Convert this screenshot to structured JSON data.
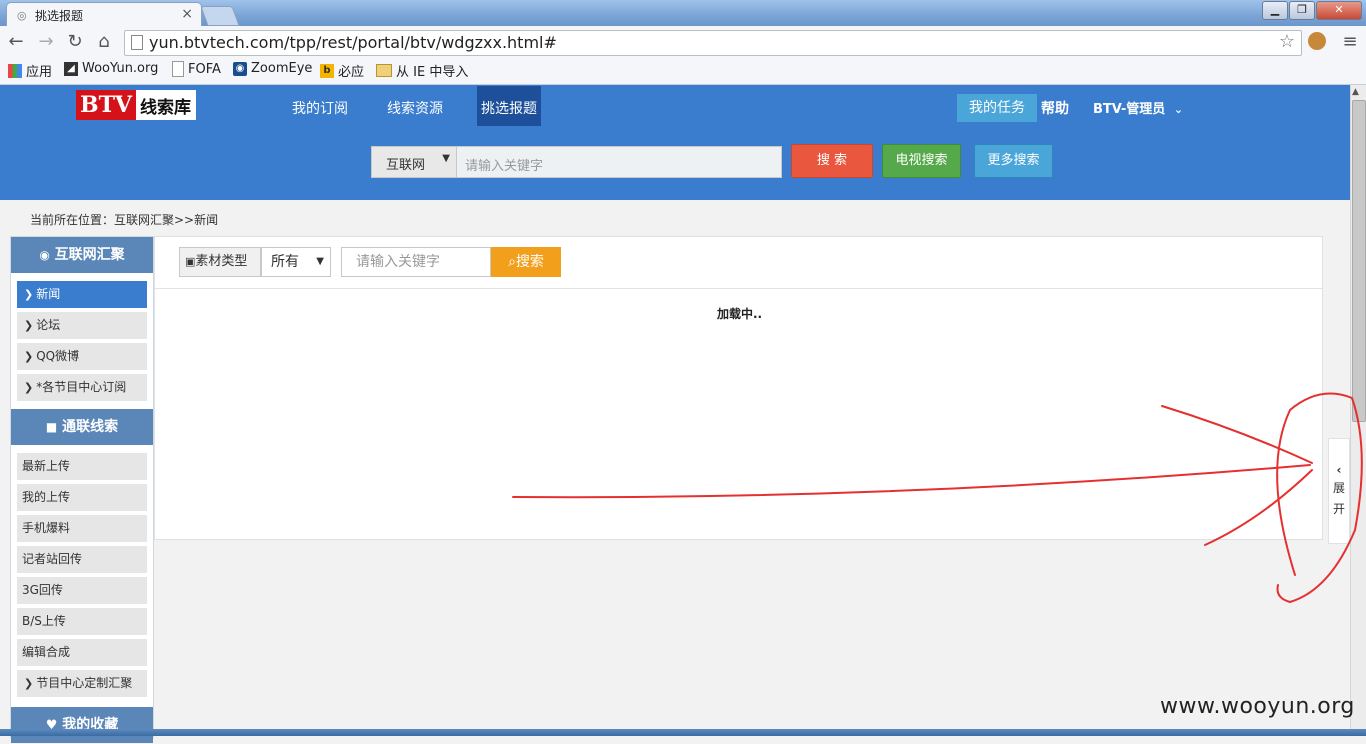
{
  "browser": {
    "tab_title": "挑选报题",
    "tab_close": "×",
    "url": "yun.btvtech.com/tpp/rest/portal/btv/wdgzxx.html#",
    "bookmarks": [
      {
        "label": "应用",
        "icon": "apps-grid-icon"
      },
      {
        "label": "WooYun.org",
        "icon": "wooyun-icon"
      },
      {
        "label": "FOFA",
        "icon": "page-icon"
      },
      {
        "label": "ZoomEye",
        "icon": "zoomeye-icon"
      },
      {
        "label": "必应",
        "icon": "bing-icon"
      },
      {
        "label": "从 IE 中导入",
        "icon": "folder-icon"
      }
    ]
  },
  "header": {
    "logo_mark": "BTV",
    "logo_text": "线索库",
    "nav": [
      "我的订阅",
      "线索资源",
      "挑选报题"
    ],
    "active_nav": "挑选报题",
    "my_task": "我的任务",
    "help": "帮助",
    "user": "BTV-管理员"
  },
  "search": {
    "scope": "互联网",
    "placeholder": "请输入关键字",
    "search_btn": "搜 索",
    "tv_search_btn": "电视搜索",
    "more_search_btn": "更多搜索"
  },
  "breadcrumb": "当前所在位置：互联网汇聚>>新闻",
  "sidebar": {
    "section1_title": "互联网汇聚",
    "section1_items": [
      "新闻",
      "论坛",
      "QQ微博",
      "*各节目中心订阅"
    ],
    "section2_title": "通联线索",
    "section2_items": [
      "最新上传",
      "我的上传",
      "手机爆料",
      "记者站回传",
      "3G回传",
      "B/S上传",
      "编辑合成"
    ],
    "section2_last": "节目中心定制汇聚",
    "section3_title": "我的收藏"
  },
  "filter": {
    "type_label": "素材类型",
    "type_value": "所有",
    "keyword_placeholder": "请输入关键字",
    "search_btn": "搜索"
  },
  "status": {
    "loading": "加载中.."
  },
  "expand": {
    "chars": [
      "展",
      "开"
    ]
  },
  "watermark": "www.wooyun.org",
  "colors": {
    "header_blue": "#3a7dce",
    "active_nav": "#1d4f9a",
    "search_red": "#e9573f",
    "tv_green": "#56a94a",
    "more_blue": "#4aa5d8",
    "orange": "#f29f1c",
    "annotation_red": "#e53030"
  }
}
